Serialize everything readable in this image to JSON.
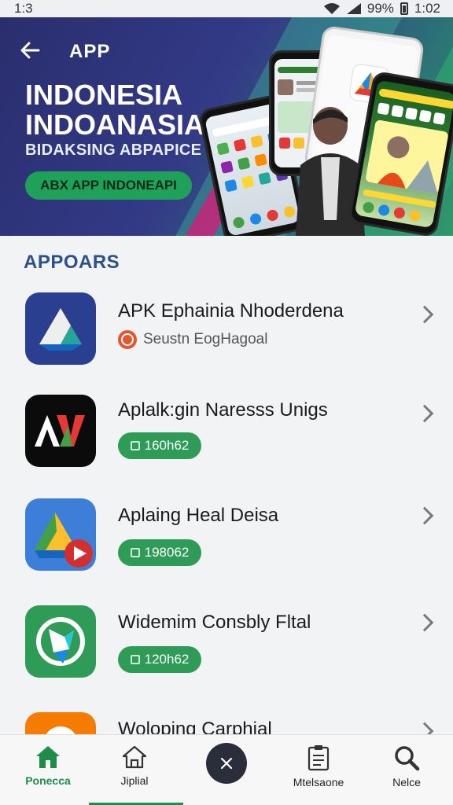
{
  "status_bar": {
    "time_left": "1:3",
    "battery": "99%",
    "time_right": "1:02"
  },
  "banner": {
    "app_label": "APP",
    "title_line1": "INDONESIA",
    "title_line2": "INDOANASIA",
    "subtitle": "BIDAKSING ABPAPICE",
    "cta_label": "ABX APP INDONEAPI",
    "colors": {
      "background": "#333a86",
      "accent": "#1fa15a",
      "stripe": "#c0287a"
    }
  },
  "section": {
    "title": "APPOARS"
  },
  "apps": [
    {
      "name": "APK Ephainia Nhoderdena",
      "developer": "Seustn EogHagoal",
      "icon": "drive-triangle-icon"
    },
    {
      "name": "Aplalk:gin Naresss Unigs",
      "size": "160h62",
      "icon": "av-logo-icon"
    },
    {
      "name": "Aplaing Heal Deisa",
      "size": "198062",
      "icon": "drive-play-icon"
    },
    {
      "name": "Widemim Consbly Fltal",
      "size": "120h62",
      "icon": "green-shape-icon"
    },
    {
      "name": "Woloping Carphial",
      "icon": "orange-app-icon"
    }
  ],
  "bottom_nav": {
    "items": [
      {
        "label": "Ponecca",
        "icon": "home-filled-icon"
      },
      {
        "label": "Jiplial",
        "icon": "home-outline-icon"
      },
      {
        "label": "Mtelsaone",
        "icon": "clipboard-icon"
      },
      {
        "label": "Nelce",
        "icon": "search-icon"
      }
    ],
    "active_color": "#1f8d4a"
  }
}
